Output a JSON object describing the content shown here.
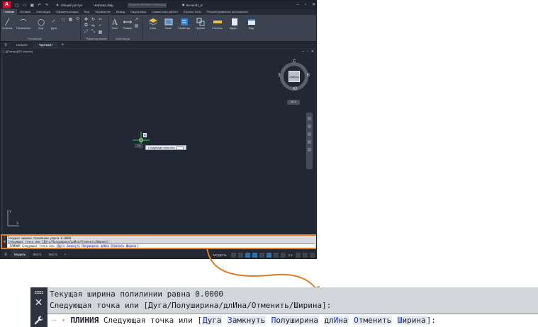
{
  "window": {
    "logo": "A",
    "share": "Общий доступ",
    "filename": "Чертеж1.dwg",
    "search_placeholder": "Введите ключевое слово/фразу",
    "user": "lecvend1_8"
  },
  "ribbon_tabs": [
    "Главная",
    "Вставка",
    "Аннотации",
    "Параметризация",
    "Вид",
    "Управление",
    "Вывод",
    "Надстройки",
    "Совместная работа",
    "Express Tools",
    "Рекомендованные приложения"
  ],
  "ribbon": {
    "draw_tools": [
      "Отрезок",
      "Полилиния",
      "Круг",
      "Дуга"
    ],
    "draw_label": "Рисование",
    "modify_label": "Редактирование",
    "annot_tools": [
      "Текст",
      "Размер"
    ],
    "annot_label": "Аннотации",
    "panels": [
      "Слои",
      "Блок",
      "Свойства",
      "Группы",
      "Утилиты",
      "Буфе...",
      "Вид"
    ]
  },
  "file_tabs": {
    "start": "Начало",
    "drawing": "Чертеж1*"
  },
  "viewport": {
    "label": "[–][Сверху][2D-каркас]",
    "viewcube": {
      "top": "Сверху",
      "n": "С",
      "s": "Ю",
      "w": "З",
      "e": "В"
    },
    "wcs": "МСК",
    "tooltip": "Следующая точка или:",
    "dyn_value": "3,5"
  },
  "command_small": {
    "line1": "Текущая ширина полилинии равна 0.0000",
    "line2": "Следующая точка или [Дуга/Полуширина/длИна/Отменить/Ширина]:",
    "cmd": "ПЛИНИЯ",
    "prompt": "Следующая точка или",
    "opts": [
      "Дуга",
      "Замкнуть",
      "Полуширина",
      "длИна",
      "Отменить",
      "Ширина"
    ]
  },
  "status_bar": {
    "tabs": [
      "Модель",
      "Лист1",
      "Лист2"
    ],
    "model": "МОДЕЛЬ",
    "scale": "1:1"
  },
  "command_zoom": {
    "line1": "Текущая ширина полилинии равна 0.0000",
    "line2": "Следующая точка или [Дуга/Полуширина/длИна/Отменить/Ширина]:",
    "cmd": "ПЛИНИЯ",
    "prompt": "Следующая точка или [",
    "opt1_k": "Д",
    "opt1_r": "уга",
    "opt2_k": "З",
    "opt2_r": "амкнуть",
    "opt3_k": "П",
    "opt3_r": "олуширина",
    "opt4_pre": "дл",
    "opt4_k": "И",
    "opt4_r": "на",
    "opt5_k": "О",
    "opt5_r": "тменить",
    "opt6_k": "Ш",
    "opt6_r": "ирина",
    "close": "]:"
  },
  "colors": {
    "accent": "#e07b1f",
    "keyword": "#1f3cc2",
    "brand": "#c8102e"
  }
}
